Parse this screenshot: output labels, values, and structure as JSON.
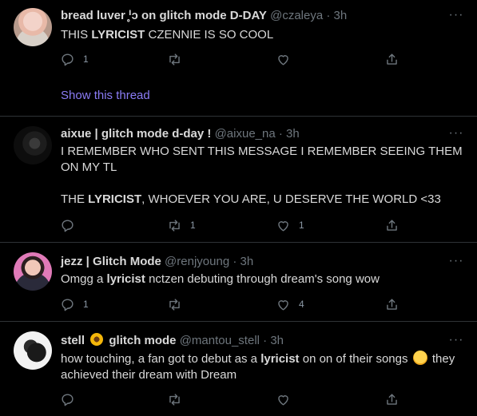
{
  "tweets": [
    {
      "name": "bread luver ᑊ̥ᴐ on glitch mode D-DAY",
      "handle": "@czaleya",
      "dot": "·",
      "time": "3h",
      "body_parts": [
        "THIS ",
        "LYRICIST",
        " CZENNIE IS SO COOL"
      ],
      "reply_count": "1",
      "retweet_count": "",
      "like_count": "",
      "show_thread": "Show this thread"
    },
    {
      "name": "aixue | glitch mode d-day !",
      "handle": "@aixue_na",
      "dot": "·",
      "time": "3h",
      "line1": "I REMEMBER WHO SENT THIS MESSAGE I REMEMBER SEEING THEM ON MY TL",
      "line2_parts": [
        "THE ",
        "LYRICIST",
        ", WHOEVER YOU ARE, U DESERVE THE WORLD <33"
      ],
      "reply_count": "",
      "retweet_count": "1",
      "like_count": "1"
    },
    {
      "name": "jezz | Glitch Mode",
      "handle": "@renjyoung",
      "dot": "·",
      "time": "3h",
      "body_parts": [
        "Omgg a ",
        "lyricist",
        " nctzen debuting through dream's song wow"
      ],
      "reply_count": "1",
      "retweet_count": "",
      "like_count": "4"
    },
    {
      "name_a": "stell",
      "name_b": "glitch mode",
      "handle": "@mantou_stell",
      "dot": "·",
      "time": "3h",
      "body_parts": [
        "how touching, a fan got to debut as a ",
        "lyricist",
        " on on of their songs",
        " they achieved their dream with Dream"
      ],
      "reply_count": "",
      "retweet_count": "",
      "like_count": ""
    }
  ],
  "icons": {
    "reply": "reply-icon",
    "retweet": "retweet-icon",
    "like": "heart-icon",
    "share": "share-icon",
    "more": "more-icon"
  },
  "colors": {
    "background": "#000000",
    "text": "#d9d9d9",
    "muted": "#6e767d",
    "link": "#8b7cf6",
    "divider": "#2f3336"
  }
}
